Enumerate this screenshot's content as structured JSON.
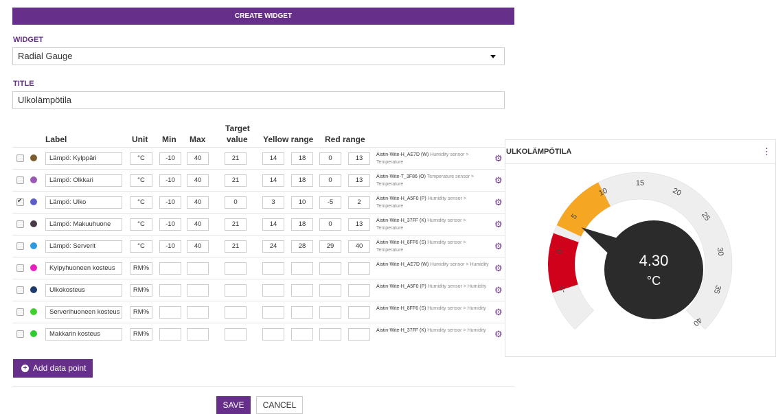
{
  "header": {
    "title": "CREATE WIDGET"
  },
  "widget_field": {
    "label": "WIDGET",
    "value": "Radial Gauge"
  },
  "title_field": {
    "label": "TITLE",
    "value": "Ulkolämpötila"
  },
  "table": {
    "headers": {
      "label": "Label",
      "unit": "Unit",
      "min": "Min",
      "max": "Max",
      "target_line1": "Target",
      "target_line2": "value",
      "yellow": "Yellow range",
      "red": "Red range"
    },
    "rows": [
      {
        "checked": false,
        "color": "#7a5c2e",
        "label": "Lämpö: Kylppäri",
        "unit": "°C",
        "min": "-10",
        "max": "40",
        "target": "21",
        "y1": "14",
        "y2": "18",
        "r1": "0",
        "r2": "13",
        "source": "Aistin-Wite-H_AE7D (W)",
        "source_type": "Humidity sensor > Temperature"
      },
      {
        "checked": false,
        "color": "#9b59b6",
        "label": "Lämpö: Olkkari",
        "unit": "°C",
        "min": "-10",
        "max": "40",
        "target": "21",
        "y1": "14",
        "y2": "18",
        "r1": "0",
        "r2": "13",
        "source": "Aistin-Wite-T_3F86 (O)",
        "source_type": "Temperature sensor > Temperature"
      },
      {
        "checked": true,
        "color": "#5b5fc7",
        "label": "Lämpö: Ulko",
        "unit": "°C",
        "min": "-10",
        "max": "40",
        "target": "0",
        "y1": "3",
        "y2": "10",
        "r1": "-5",
        "r2": "2",
        "source": "Aistin-Wite-H_A5F0 (P)",
        "source_type": "Humidity sensor > Temperature"
      },
      {
        "checked": false,
        "color": "#4a3b4a",
        "label": "Lämpö: Makuuhuone",
        "unit": "°C",
        "min": "-10",
        "max": "40",
        "target": "21",
        "y1": "14",
        "y2": "18",
        "r1": "0",
        "r2": "13",
        "source": "Aistin-Wite-H_37FF (K)",
        "source_type": "Humidity sensor > Temperature"
      },
      {
        "checked": false,
        "color": "#2e9be0",
        "label": "Lämpö: Serverit",
        "unit": "°C",
        "min": "-10",
        "max": "40",
        "target": "21",
        "y1": "24",
        "y2": "28",
        "r1": "29",
        "r2": "40",
        "source": "Aistin-Wite-H_8FF6 (S)",
        "source_type": "Humidity sensor > Temperature"
      },
      {
        "checked": false,
        "color": "#e91ec0",
        "label": "Kylpyhuoneen kosteus",
        "unit": "RM%",
        "min": "",
        "max": "",
        "target": "",
        "y1": "",
        "y2": "",
        "r1": "",
        "r2": "",
        "source": "Aistin-Wite-H_AE7D (W)",
        "source_type": "Humidity sensor > Humidity"
      },
      {
        "checked": false,
        "color": "#1e3a6e",
        "label": "Ulkokosteus",
        "unit": "RM%",
        "min": "",
        "max": "",
        "target": "",
        "y1": "",
        "y2": "",
        "r1": "",
        "r2": "",
        "source": "Aistin-Wite-H_A5F0 (P)",
        "source_type": "Humidity sensor > Humidity"
      },
      {
        "checked": false,
        "color": "#3fcf2e",
        "label": "Serverihuoneen kosteus",
        "unit": "RM%",
        "min": "",
        "max": "",
        "target": "",
        "y1": "",
        "y2": "",
        "r1": "",
        "r2": "",
        "source": "Aistin-Wite-H_8FF6 (S)",
        "source_type": "Humidity sensor > Humidity"
      },
      {
        "checked": false,
        "color": "#2ecc2e",
        "label": "Makkarin kosteus",
        "unit": "RM%",
        "min": "",
        "max": "",
        "target": "",
        "y1": "",
        "y2": "",
        "r1": "",
        "r2": "",
        "source": "Aistin-Wite-H_37FF (K)",
        "source_type": "Humidity sensor > Humidity"
      }
    ]
  },
  "buttons": {
    "add": "Add data point",
    "save": "SAVE",
    "cancel": "CANCEL"
  },
  "preview": {
    "title": "ULKOLÄMPÖTILA",
    "value": "4.30",
    "unit": "°C",
    "gauge": {
      "min": -10,
      "max": 40,
      "value": 4.3,
      "yellow_range": [
        3,
        10
      ],
      "red_range": [
        -5,
        2
      ],
      "tick_labels": [
        "-5",
        "0",
        "5",
        "10",
        "15",
        "20",
        "25",
        "30",
        "35",
        "40"
      ],
      "colors": {
        "yellow": "#f5a623",
        "red": "#d0021b",
        "dial": "#2b2b2b",
        "track": "#eeeeee"
      }
    }
  },
  "colors": {
    "accent": "#662f8a"
  }
}
